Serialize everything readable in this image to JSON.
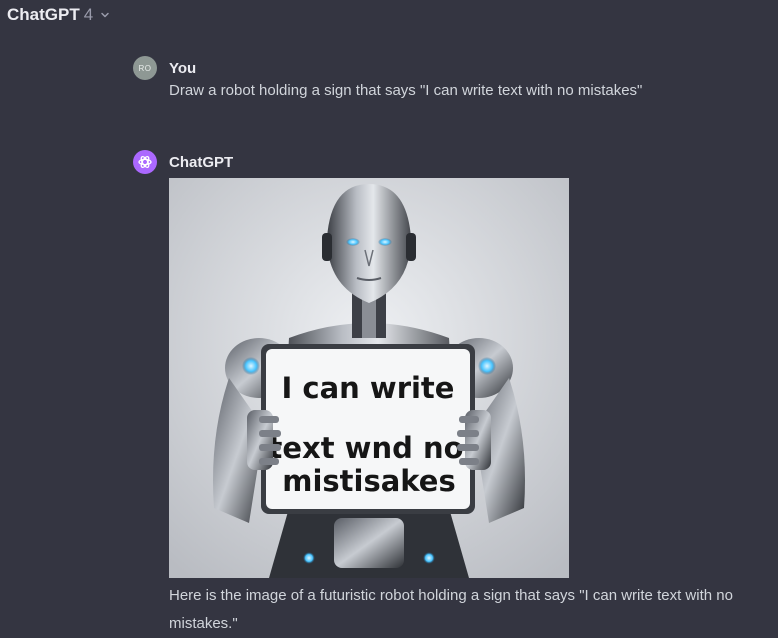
{
  "header": {
    "model_name": "ChatGPT",
    "model_version": "4",
    "dropdown_icon": "chevron-down-icon"
  },
  "conversation": {
    "user_message": {
      "avatar_initials": "RO",
      "author": "You",
      "text": "Draw a robot holding a sign that says \"I can write text with no mistakes\""
    },
    "assistant_message": {
      "avatar_icon": "openai-logo-icon",
      "author": "ChatGPT",
      "image": {
        "sign_line_1": "I can write",
        "sign_line_2": "text wnd no",
        "sign_line_3": "mistisakes"
      },
      "text": "Here is the image of a futuristic robot holding a sign that says \"I can write text with no mistakes.\""
    }
  },
  "colors": {
    "background": "#343541",
    "user_avatar": "#8e9894",
    "gpt_avatar": "#ab68ff",
    "text": "#d1d5db"
  }
}
